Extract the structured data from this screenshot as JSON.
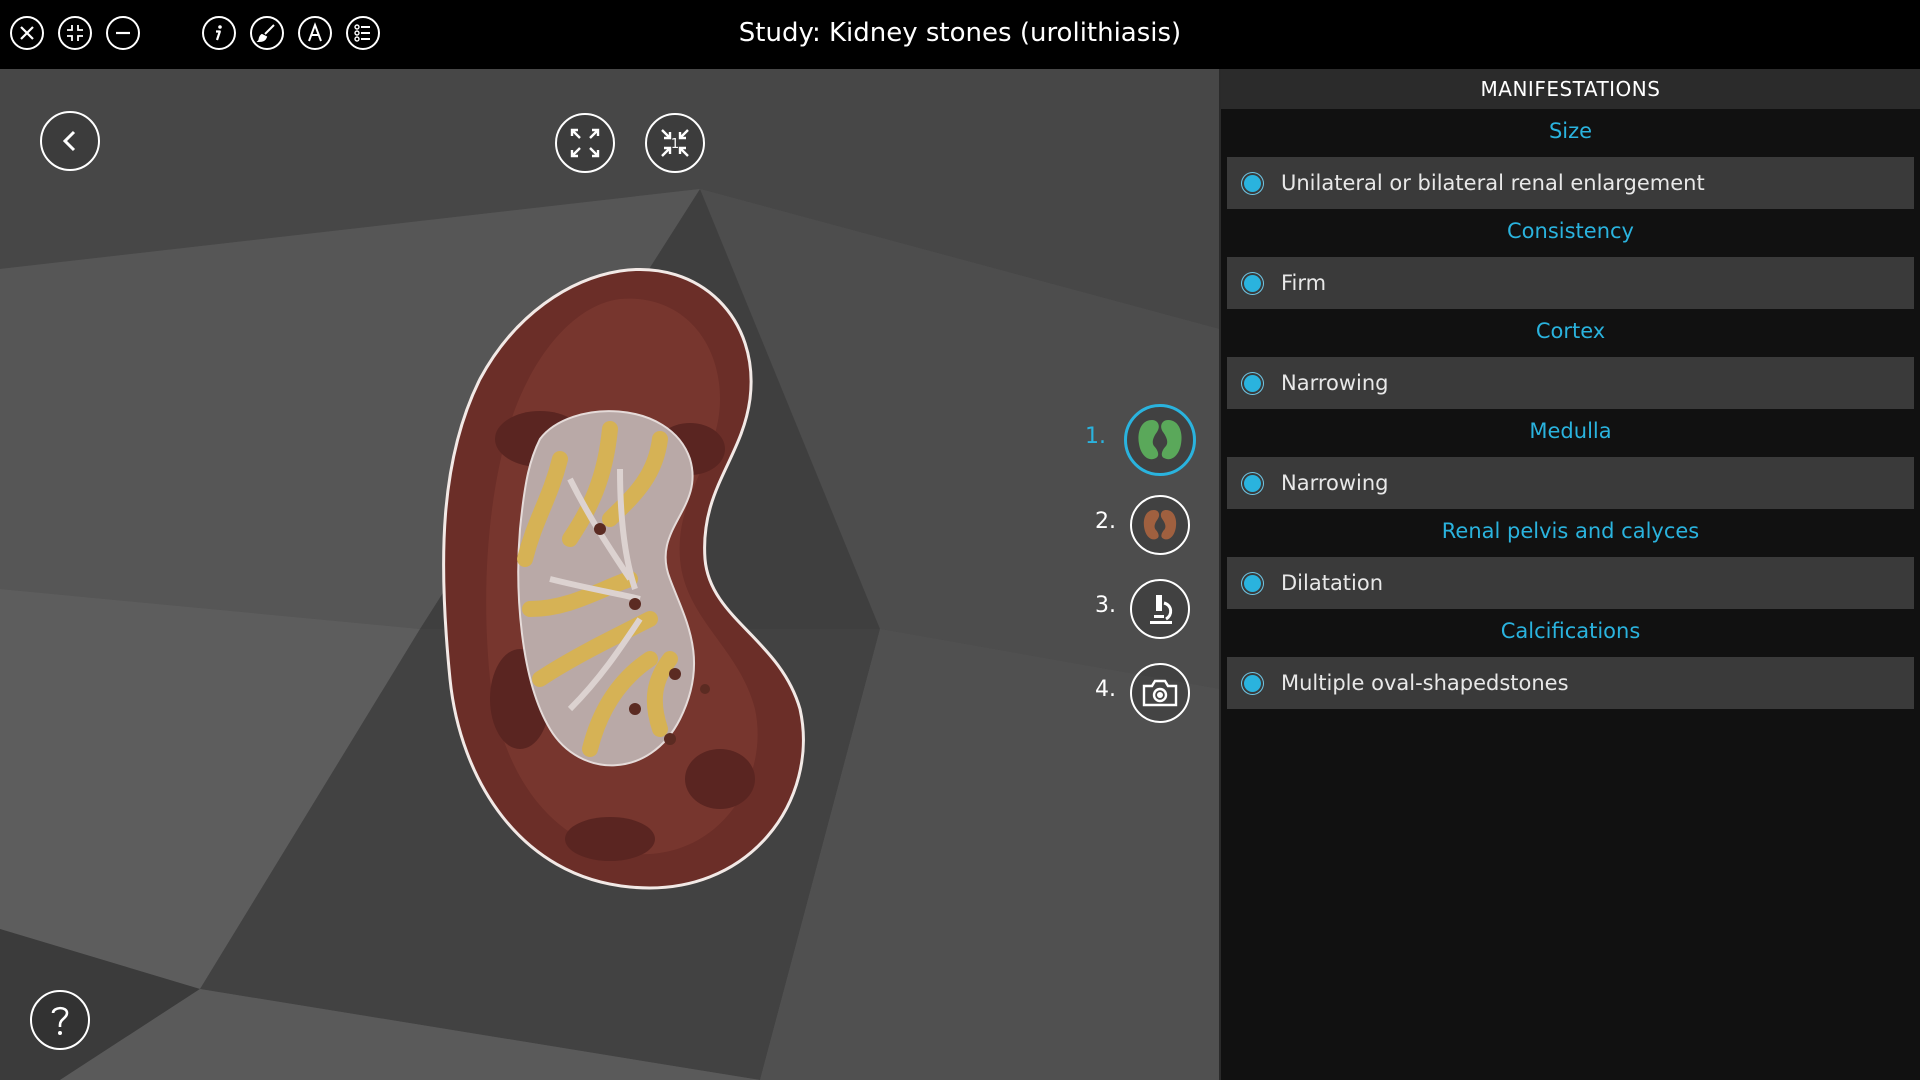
{
  "window": {
    "title": "Study: Kidney stones (urolithiasis)"
  },
  "toolbar": {
    "left_icons": [
      "close-icon",
      "collapse-icon",
      "minus-icon"
    ],
    "tool_icons": [
      "info-icon",
      "brush-icon",
      "annotation-icon",
      "list-icon"
    ]
  },
  "viewport": {
    "view_buttons": [
      "expand-icon",
      "focus-icon"
    ],
    "focus_badge": "1",
    "steps": [
      {
        "num": "1.",
        "icon": "kidney-icon",
        "active": true,
        "color": "#5aa85a"
      },
      {
        "num": "2.",
        "icon": "kidney-icon",
        "active": false,
        "color": "#a0603f"
      },
      {
        "num": "3.",
        "icon": "microscope-icon",
        "active": false
      },
      {
        "num": "4.",
        "icon": "camera-icon",
        "active": false
      }
    ],
    "help_icon": "help-icon",
    "back_icon": "back-icon"
  },
  "panel": {
    "title": "MANIFESTATIONS",
    "sections": [
      {
        "heading": "Size",
        "item": "Unilateral or bilateral renal enlargement"
      },
      {
        "heading": "Consistency",
        "item": "Firm"
      },
      {
        "heading": "Cortex",
        "item": "Narrowing"
      },
      {
        "heading": "Medulla",
        "item": "Narrowing"
      },
      {
        "heading": "Renal pelvis and calyces",
        "item": "Dilatation"
      },
      {
        "heading": "Calcifications",
        "item": "Multiple oval-shapedstones"
      }
    ]
  },
  "colors": {
    "accent": "#2ab3de",
    "panel_bg": "#111111",
    "item_bg": "#3a3a3a"
  }
}
